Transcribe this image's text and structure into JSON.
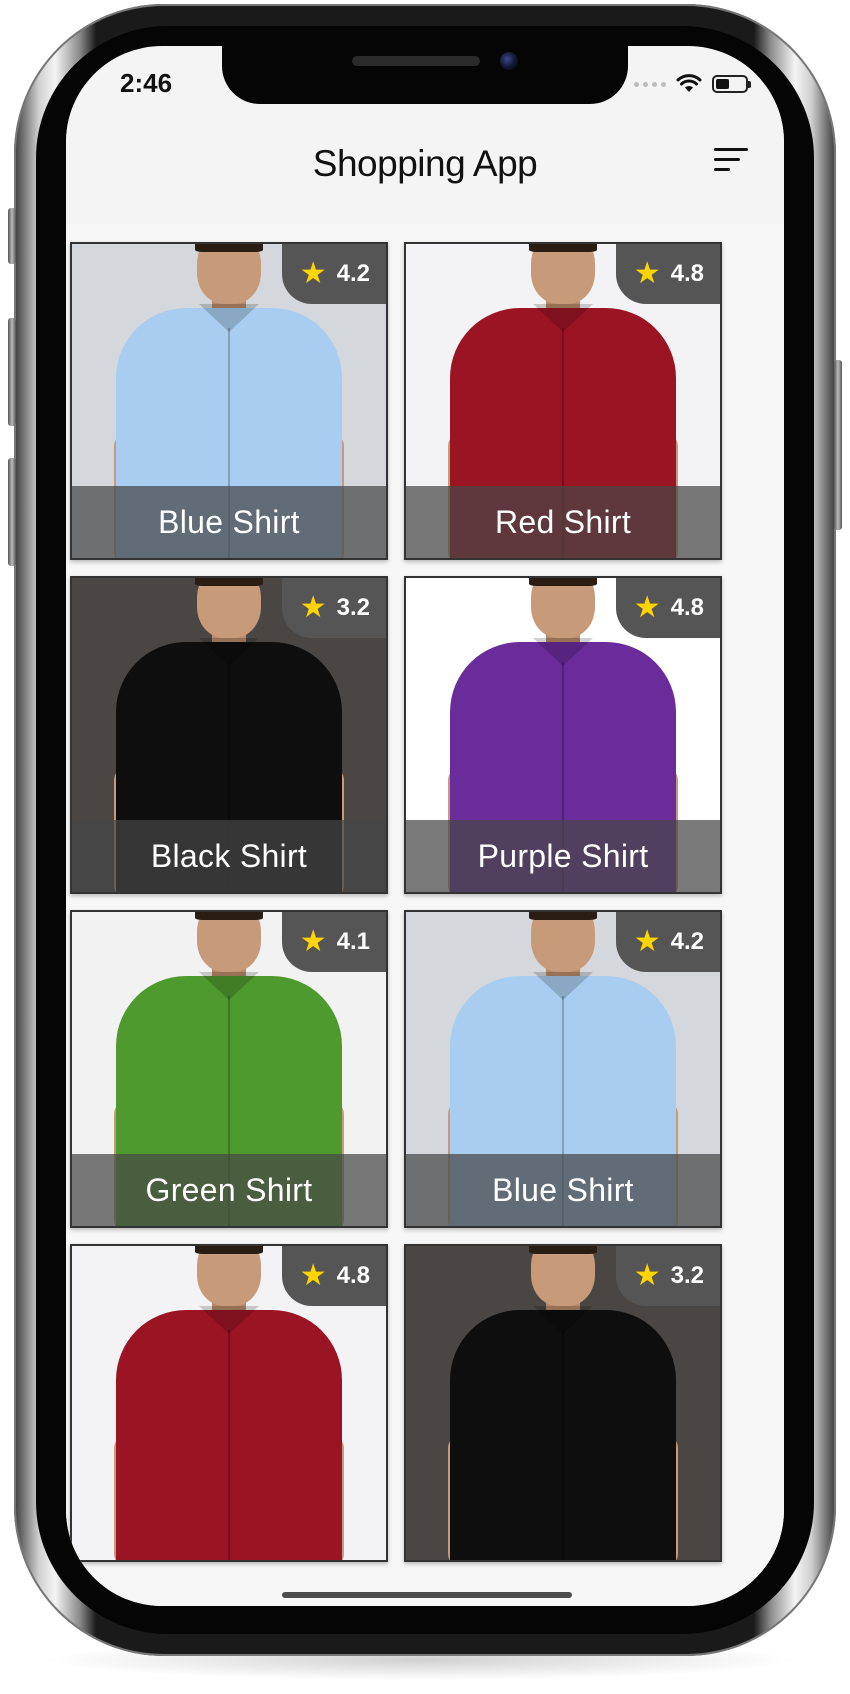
{
  "status_bar": {
    "time": "2:46",
    "battery_level": 0.45
  },
  "app_bar": {
    "title": "Shopping App",
    "sort_icon": "sort-lines-icon"
  },
  "products": [
    {
      "name": "Blue Shirt",
      "rating": "4.2",
      "shirt_color": "#a8cdf0",
      "bg_color": "#d4d8dc"
    },
    {
      "name": "Red Shirt",
      "rating": "4.8",
      "shirt_color": "#9b1424",
      "bg_color": "#f3f3f5"
    },
    {
      "name": "Black Shirt",
      "rating": "3.2",
      "shirt_color": "#0e0e0e",
      "bg_color": "#4a4644"
    },
    {
      "name": "Purple Shirt",
      "rating": "4.8",
      "shirt_color": "#6a2c9a",
      "bg_color": "#ffffff"
    },
    {
      "name": "Green Shirt",
      "rating": "4.1",
      "shirt_color": "#4f9a2e",
      "bg_color": "#f2f2f2"
    },
    {
      "name": "Blue Shirt",
      "rating": "4.2",
      "shirt_color": "#a8cdf0",
      "bg_color": "#d4d8dc"
    },
    {
      "name": "",
      "rating": "4.8",
      "shirt_color": "#9b1424",
      "bg_color": "#f3f3f5"
    },
    {
      "name": "",
      "rating": "3.2",
      "shirt_color": "#0e0e0e",
      "bg_color": "#4a4644"
    }
  ],
  "colors": {
    "badge_bg": "#555555",
    "star": "#ffd400",
    "caption_overlay": "#464646"
  }
}
